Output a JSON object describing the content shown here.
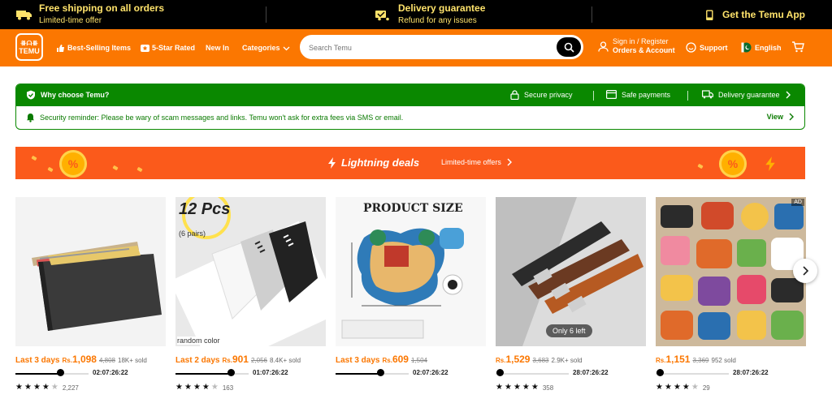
{
  "topbar": {
    "shipping_title": "Free shipping on all orders",
    "shipping_sub": "Limited-time offer",
    "delivery_title": "Delivery guarantee",
    "delivery_sub": "Refund for any issues",
    "app_label": "Get the Temu App"
  },
  "header": {
    "logo_top": "ꗥᗩꗥ",
    "logo_text": "TEMU",
    "nav": {
      "best_selling": "Best-Selling Items",
      "five_star": "5-Star Rated",
      "new_in": "New In",
      "categories": "Categories"
    },
    "search_placeholder": "Search Temu",
    "signin_line1": "Sign in / Register",
    "signin_line2": "Orders & Account",
    "support": "Support",
    "language": "English"
  },
  "why_choose": {
    "title": "Why choose Temu?",
    "features": [
      "Secure privacy",
      "Safe payments",
      "Delivery guarantee"
    ],
    "reminder": "Security reminder: Please be wary of scam messages and links. Temu won't ask for extra fees via SMS or email.",
    "view": "View"
  },
  "lightning": {
    "title": "Lightning deals",
    "subtitle": "Limited-time offers"
  },
  "products": [
    {
      "tag": "Last 3 days",
      "currency": "Rs.",
      "price": "1,098",
      "old": "4,808",
      "sold": "18K+ sold",
      "time": "02:07:26:22",
      "progress": 0.6,
      "rating": "4.5",
      "reviews": "2,227"
    },
    {
      "tag": "Last 2 days",
      "currency": "Rs.",
      "price": "901",
      "old": "2,056",
      "sold": "8.4K+ sold",
      "time": "01:07:26:22",
      "progress": 0.75,
      "rating": "4.5",
      "reviews": "163",
      "img_label": "12 Pcs",
      "img_sub": "(6 pairs)",
      "img_caption": "random color"
    },
    {
      "tag": "Last 3 days",
      "currency": "Rs.",
      "price": "609",
      "old": "1,504",
      "sold": "",
      "time": "02:07:26:22",
      "progress": 0.6,
      "rating": "",
      "reviews": "",
      "img_label": "PRODUCT SIZE"
    },
    {
      "tag": "",
      "currency": "Rs.",
      "price": "1,529",
      "old": "3,683",
      "sold": "2.9K+ sold",
      "time": "28:07:26:22",
      "progress": 0.0,
      "rating": "5",
      "reviews": "358",
      "badge": "Only 6 left"
    },
    {
      "tag": "",
      "currency": "Rs.",
      "price": "1,151",
      "old": "3,369",
      "sold": "952 sold",
      "time": "28:07:26:22",
      "progress": 0.0,
      "rating": "4.5",
      "reviews": "29",
      "ad": "AD"
    }
  ],
  "colors": {
    "header": "#fb7701",
    "lightning": "#fb5a1b",
    "why_green": "#0a8800",
    "price": "#fb7701"
  }
}
